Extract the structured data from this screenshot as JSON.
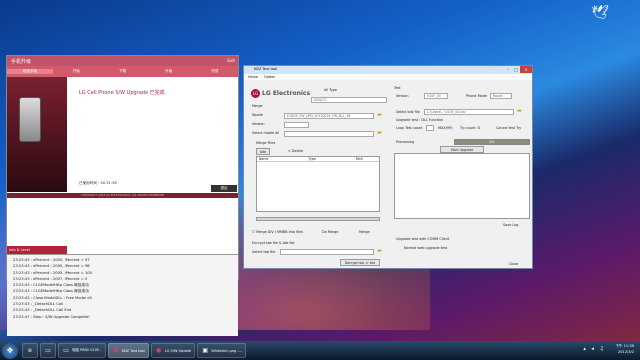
{
  "upgrade_window": {
    "title": "手机升级",
    "close": "Exit",
    "steps": [
      "检查手机",
      "开始",
      "下载",
      "升级",
      "完成"
    ],
    "headline": "LG Cell Phone S/W Upgrade 已完成",
    "elapsed": "已使用时间 : 00:31:36",
    "ok_button": "退出",
    "copyright": "COPYRIGHT 2012 LG ELECTRONICS. ALL RIGHTS RESERVED",
    "log_label": "Info & Level",
    "log": [
      "23:23:43 : ePercent : 2005,  iPercent = 97",
      "23:23:43 : ePercent : 2005,  iPercent = 98",
      "23:23:43 : ePercent : 2005,  iPercent = 100",
      "23:23:43 : ePercent : 2007,  iPercent = 0",
      "23:23:43 : CLGEModelHttp Class 释放成功",
      "23:23:43 : CLGEModelHttp Class 释放成功",
      "23:23:43 : Close:ModelDLL : Free Model dll",
      "23:23:43 : _DetachDLL Call",
      "23:23:43 : _DetachDLL Call End",
      "23:23:47 : Step : S/W Upgrade Complete!"
    ]
  },
  "tool": {
    "title": "KDZ Test tool",
    "menu": [
      "Home",
      "Option"
    ],
    "logo": "LG Electronics",
    "dll_type_label": "dll Type",
    "dll_type_value": "DGQC3",
    "merge_label": "Merge",
    "wpath_label": "Wpath",
    "wpath_value": "E:\\KDZ_FW_UPD_20120226_FW_DLL_38",
    "version_label": "Version",
    "select_model_label": "Select model dll",
    "merge_files_label": "Merge Files",
    "add_label": "Add",
    "delete_label": "Delete",
    "col_name": "Name",
    "col_type": "Type",
    "col_path": "Path",
    "merge_check_label": "Merge DIV / MMBB into files",
    "encrypt_btn": "Do Merge",
    "merge_btn": "Merge",
    "encrypt_label": "Encrypt tab file & tab file",
    "select_tab_label": "Select tab file",
    "decrypt_btn": "Decrypt tab -> kdz",
    "test_label": "Test",
    "test_version_label": "Version",
    "test_version_value": "V10F_00",
    "phone_mode_label": "Phone Mode",
    "phone_mode_value": "Board",
    "select_kdz_label": "Select kdz file",
    "kdz_path": "C:\\Users\\...\\V10F_00.kdz",
    "upgrade_test_label": "Upgrade test : DLL Function",
    "loop_label": "Loop Test count",
    "loop_value": "MAX(99)",
    "try_label": "Try count :",
    "try_value": "0",
    "cancel_label": "Cancel test Try",
    "processing_label": "Processing",
    "progress_text": "0%",
    "start_btn": "Start Upgrade",
    "save_log": "Save Log",
    "upgrade_test_comm": "Upgrade test with COMM Client",
    "normal_web": "Normal web upgrade test",
    "close_btn": "Close"
  },
  "taskbar": {
    "items": [
      "电脑 P880 V10F...",
      "KDZ Test tool",
      "LG S/W Update",
      "Whiteskin.png -..."
    ],
    "time": "下午 11:39",
    "date": "2012/3/2"
  },
  "colors": {
    "accent": "#b0243a",
    "window_frame": "#6c8ab0"
  }
}
